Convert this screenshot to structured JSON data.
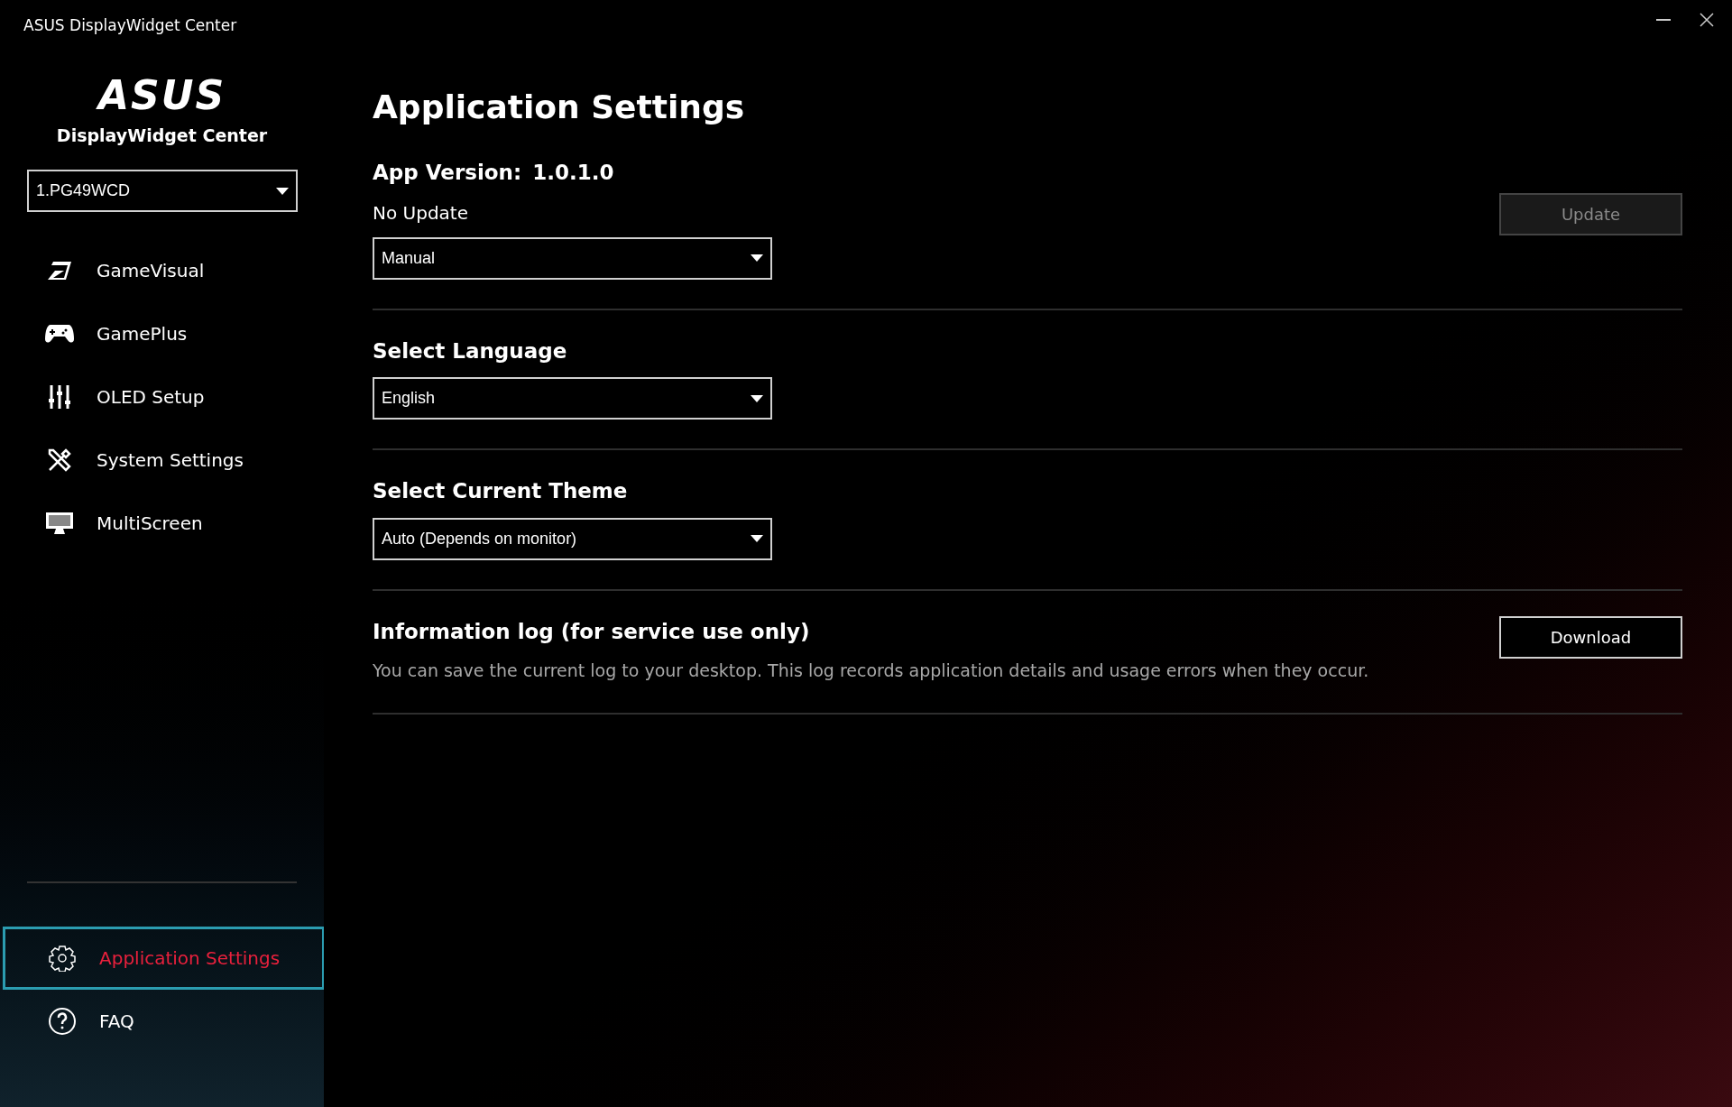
{
  "window": {
    "title": "ASUS DisplayWidget Center"
  },
  "sidebar": {
    "logo": "ASUS",
    "product": "DisplayWidget Center",
    "monitor_select": {
      "value": "1.PG49WCD"
    },
    "items": [
      {
        "label": "GameVisual",
        "kind": "gamevisual",
        "selected": false
      },
      {
        "label": "GamePlus",
        "kind": "gamepad",
        "selected": false
      },
      {
        "label": "OLED Setup",
        "kind": "sliders",
        "selected": false
      },
      {
        "label": "System Settings",
        "kind": "tools",
        "selected": false
      },
      {
        "label": "MultiScreen",
        "kind": "monitor",
        "selected": false
      }
    ],
    "bottom_items": [
      {
        "label": "Application Settings",
        "kind": "gear",
        "selected": true
      },
      {
        "label": "FAQ",
        "kind": "help",
        "selected": false
      }
    ]
  },
  "main": {
    "title": "Application Settings",
    "sections": [
      {
        "kind": "version",
        "heading": "App Version:",
        "version": "1.0.1.0",
        "status": "No Update",
        "select": {
          "value": "Manual"
        },
        "button": {
          "label": "Update",
          "disabled": true
        }
      },
      {
        "kind": "select",
        "heading": "Select Language",
        "select": {
          "value": "English"
        }
      },
      {
        "kind": "select",
        "heading": "Select Current Theme",
        "select": {
          "value": "Auto (Depends on monitor)"
        }
      },
      {
        "kind": "log",
        "heading": "Information log (for service use only)",
        "description": "You can save the current log to your desktop. This log records application details and usage errors when they occur.",
        "button": {
          "label": "Download",
          "disabled": false
        }
      }
    ]
  }
}
